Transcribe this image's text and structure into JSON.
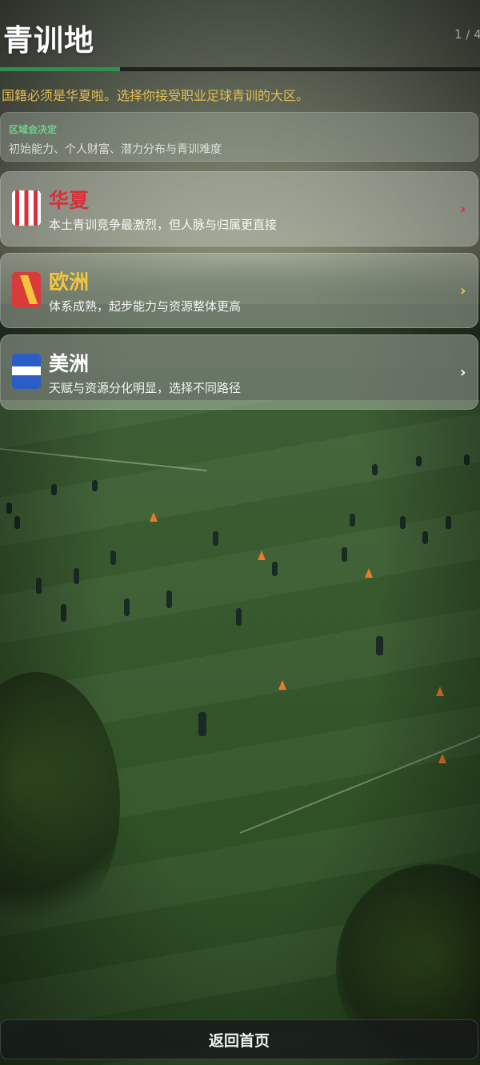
{
  "header": {
    "title": "青训地",
    "step": "1 / 4",
    "progress": 0.25
  },
  "subtitle": "国籍必须是华夏啦。选择你接受职业足球青训的大区。",
  "info_card": {
    "tag": "区域会决定",
    "description": "初始能力、个人财富、潜力分布与青训难度"
  },
  "regions": [
    {
      "name": "华夏",
      "description": "本土青训竞争最激烈，但人脉与归属更直接",
      "icon": "vertical-red-stripes-flag-icon",
      "name_color": "#d9303a",
      "chevron_color": "#d9303a"
    },
    {
      "name": "欧洲",
      "description": "体系成熟，起步能力与资源整体更高",
      "icon": "diagonal-yellow-stripe-flag-icon",
      "name_color": "#f2c53d",
      "chevron_color": "#f2c53d"
    },
    {
      "name": "美洲",
      "description": "天赋与资源分化明显，选择不同路径",
      "icon": "horizontal-white-band-flag-icon",
      "name_color": "#ffffff",
      "chevron_color": "#ffffff"
    }
  ],
  "chevron_glyph": "›",
  "back_button": {
    "label": "返回首页"
  },
  "colors": {
    "accent_progress": "#2f8f52",
    "subtitle_gold": "#e3bd4f",
    "tag_green": "#6fd08a"
  }
}
